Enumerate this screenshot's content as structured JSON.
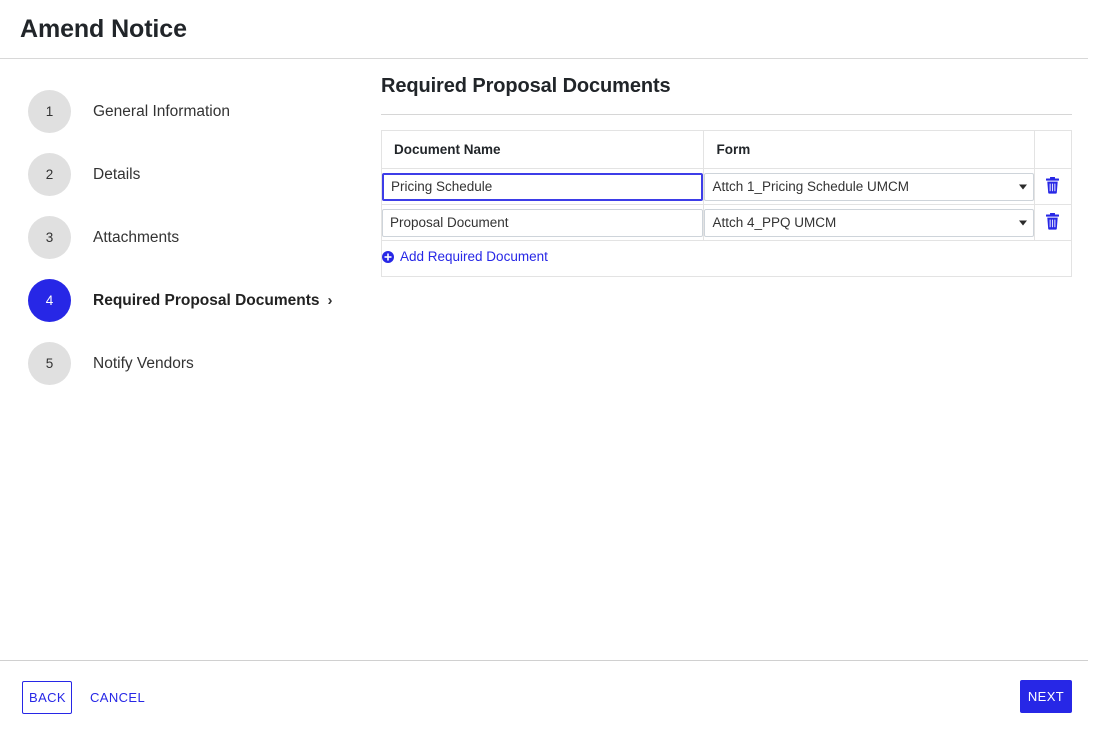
{
  "header": {
    "title": "Amend Notice"
  },
  "stepper": {
    "active_step": 4,
    "items": [
      {
        "number": "1",
        "label": "General Information",
        "active": false
      },
      {
        "number": "2",
        "label": "Details",
        "active": false
      },
      {
        "number": "3",
        "label": "Attachments",
        "active": false
      },
      {
        "number": "4",
        "label": "Required Proposal Documents",
        "active": true,
        "chevron": "›"
      },
      {
        "number": "5",
        "label": "Notify Vendors",
        "active": false
      }
    ]
  },
  "main": {
    "section_title": "Required Proposal Documents",
    "table": {
      "columns": [
        "Document Name",
        "Form",
        ""
      ],
      "rows": [
        {
          "document_name": "Pricing Schedule",
          "form": "Attch 1_Pricing Schedule UMCM",
          "focused": true,
          "delete_title": "Delete"
        },
        {
          "document_name": "Proposal Document",
          "form": "Attch 4_PPQ UMCM",
          "focused": false,
          "delete_title": "Delete"
        }
      ],
      "add_row_label": "Add Required Document"
    }
  },
  "footer": {
    "back_label": "BACK",
    "cancel_label": "CANCEL",
    "next_label": "NEXT"
  },
  "colors": {
    "accent": "#2727e6",
    "step_inactive": "#e0e0e0",
    "border": "#e3e3e3",
    "text": "#212529"
  }
}
